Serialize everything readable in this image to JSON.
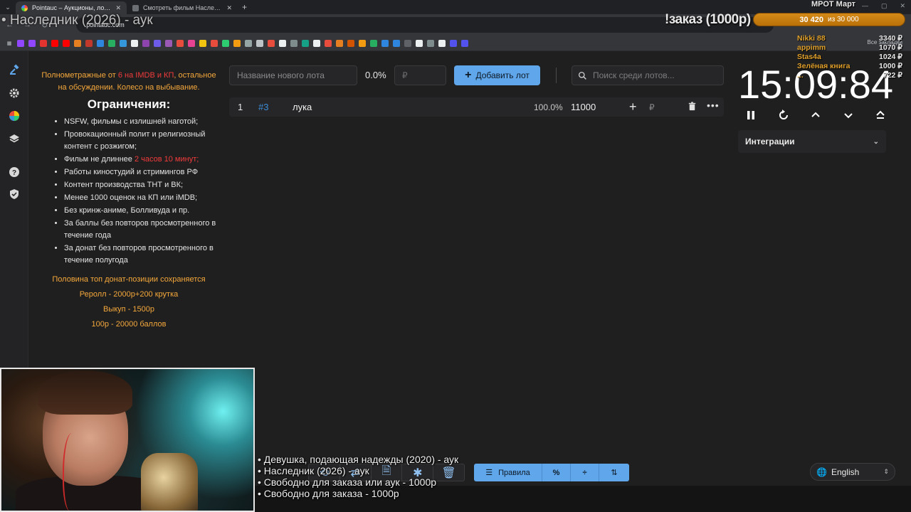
{
  "browser": {
    "tabs": [
      {
        "title": "Pointauc – Аукционы, лотереи",
        "active": true
      },
      {
        "title": "Смотреть фильм Наследник о",
        "active": false
      }
    ],
    "url": "pointauc.com",
    "all_bookmarks": "Все закладки"
  },
  "rules": {
    "intro_a": "Полнометражные от ",
    "intro_red": "6 на IMDB и КП",
    "intro_b": ", остальное на обсуждении. Колесо на выбывание.",
    "heading": "Ограничения:",
    "items": [
      {
        "text": "NSFW, фильмы с излишней наготой;"
      },
      {
        "text": "Провокационный полит и религиозный контент с розжигом;"
      },
      {
        "text": "Фильм не длиннее ",
        "red": "2 часов 10 минут;"
      },
      {
        "text": "Работы киностудий и стримингов РФ"
      },
      {
        "text": "Контент производства ТНТ и ВК;"
      },
      {
        "text": "Менее 1000 оценок на КП или iMDB;"
      },
      {
        "text": "Без кринж-аниме, Болливуда и пр."
      },
      {
        "text": "За баллы без повторов просмотренного в течение года"
      },
      {
        "text": "За донат без повторов просмотренного в течение полугода"
      }
    ],
    "footer": [
      "Половина топ донат-позиции сохраняется",
      "Реролл - 2000р+200 крутка",
      "Выкуп - 1500р",
      "100р - 20000 баллов"
    ]
  },
  "toolbar": {
    "lot_placeholder": "Название нового лота",
    "percent": "0.0%",
    "price_placeholder": "₽",
    "add_label": "Добавить лот",
    "search_placeholder": "Поиск среди лотов..."
  },
  "lots": [
    {
      "num": "1",
      "id": "#3",
      "name": "лука",
      "percent": "100.0%",
      "amount": "11000",
      "currency": "₽"
    }
  ],
  "timer": {
    "value": "15:09:84"
  },
  "integrations_label": "Интеграции",
  "bottom_bar": {
    "rules_label": "Правила"
  },
  "language": "English",
  "overlay": {
    "title": "• Наследник (2026) - аук",
    "order": "!заказ (1000р)",
    "mrot": "МРОТ Март",
    "goal_current": "30 420",
    "goal_of": "из 30 000",
    "donations": [
      {
        "name": "Nikki 88",
        "amount": "3340 ₽"
      },
      {
        "name": "appimm",
        "amount": "1070 ₽"
      },
      {
        "name": "Stas4a",
        "amount": "1024 ₽"
      },
      {
        "name": "Зелёная книга",
        "amount": "1000 ₽"
      },
      {
        "name": "...",
        "amount": "722 ₽"
      }
    ],
    "queue": [
      "• Девушка, подающая надежды (2020) - аук",
      "• Наследник (2026) - аук",
      "• Свободно для заказа или аук - 1000р",
      "• Свободно для заказа - 1000р"
    ]
  },
  "colors": {
    "accent": "#5fa6ea",
    "warning": "#f5a83a",
    "danger": "#f23b3b",
    "id_blue": "#3c8cd6"
  }
}
